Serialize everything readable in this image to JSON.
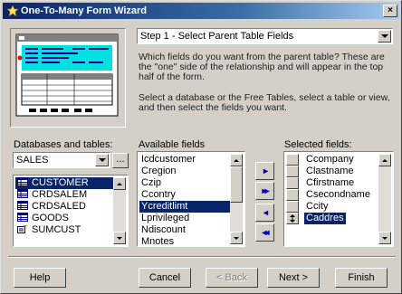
{
  "window": {
    "title": "One-To-Many Form Wizard",
    "close_label": "×"
  },
  "step_combo": {
    "value": "Step 1 - Select Parent Table Fields"
  },
  "instructions": {
    "para1": "Which fields do you want from the parent table? These are the \"one\" side of the relationship and will appear in the top half of the form.",
    "para2": "Select a database or the Free Tables, select a table or view, and then select the fields you want."
  },
  "databases": {
    "label": "Databases and tables:",
    "combo_value": "SALES",
    "browse_label": "...",
    "items": [
      {
        "label": "CUSTOMER",
        "selected": true,
        "icon": "table-icon"
      },
      {
        "label": "CRDSALEM",
        "selected": false,
        "icon": "table-icon"
      },
      {
        "label": "CRDSALED",
        "selected": false,
        "icon": "table-icon"
      },
      {
        "label": "GOODS",
        "selected": false,
        "icon": "table-icon"
      },
      {
        "label": "SUMCUST",
        "selected": false,
        "icon": "view-icon"
      }
    ]
  },
  "available": {
    "label": "Available fields",
    "items": [
      {
        "label": "Icdcustomer",
        "selected": false
      },
      {
        "label": "Cregion",
        "selected": false
      },
      {
        "label": "Czip",
        "selected": false
      },
      {
        "label": "Ccontry",
        "selected": false
      },
      {
        "label": "Ycreditlimt",
        "selected": true
      },
      {
        "label": "Lprivileged",
        "selected": false
      },
      {
        "label": "Ndiscount",
        "selected": false
      },
      {
        "label": "Mnotes",
        "selected": false
      }
    ]
  },
  "move_buttons": [
    {
      "name": "add-button",
      "glyph": "▸"
    },
    {
      "name": "add-all-button",
      "glyph": "▸▸"
    },
    {
      "name": "remove-button",
      "glyph": "◂"
    },
    {
      "name": "remove-all-button",
      "glyph": "◂◂"
    }
  ],
  "selected": {
    "label": "Selected fields:",
    "items": [
      {
        "label": "Ccompany",
        "selected": false
      },
      {
        "label": "Clastname",
        "selected": false
      },
      {
        "label": "Cfirstname",
        "selected": false
      },
      {
        "label": "Csecondname",
        "selected": false
      },
      {
        "label": "Ccity",
        "selected": false
      },
      {
        "label": "Caddres",
        "selected": true
      }
    ]
  },
  "buttons": {
    "help": "Help",
    "cancel": "Cancel",
    "back": "< Back",
    "next": "Next >",
    "finish": "Finish"
  },
  "colors": {
    "selection": "#0a246a",
    "title_gradient_start": "#0a246a",
    "face": "#d4d0c8"
  }
}
